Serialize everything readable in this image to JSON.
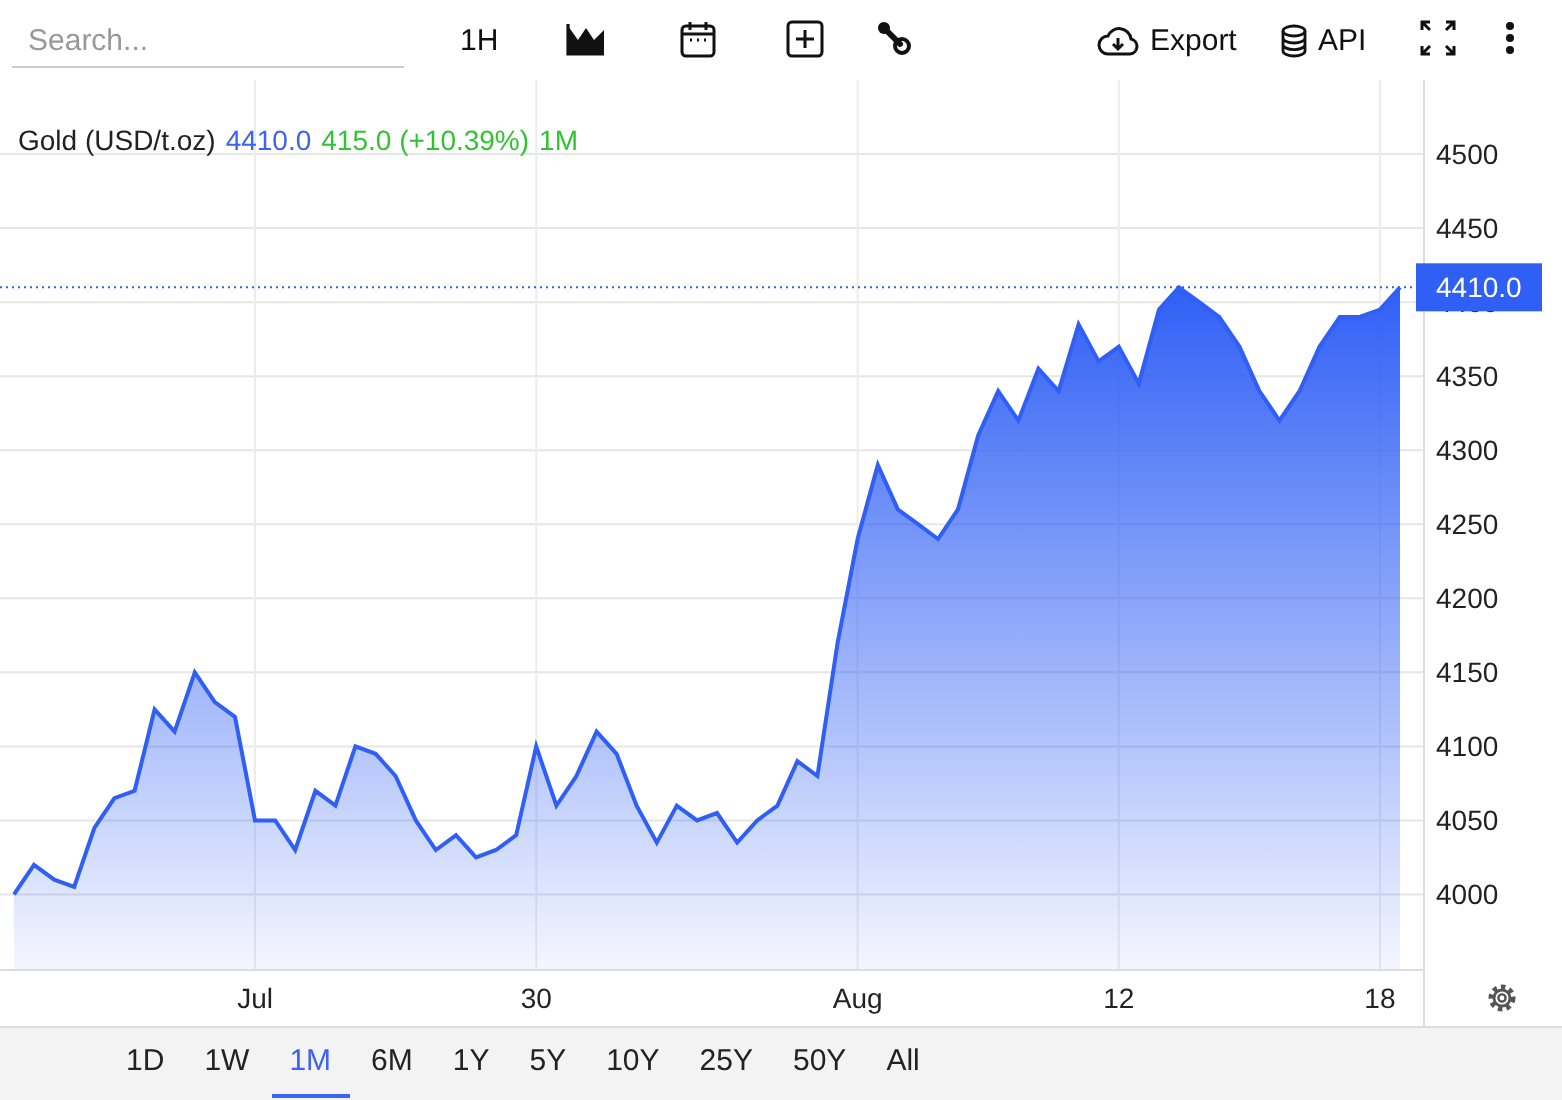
{
  "toolbar": {
    "search": {
      "placeholder": "Search..."
    },
    "interval": "1H",
    "export": "Export",
    "api": "API"
  },
  "legend": {
    "price": "4410.0",
    "change": "415.0 (+10.39%)",
    "period": "1M"
  },
  "price_tag": "4410.0",
  "chart_data": {
    "type": "area",
    "categories": [
      null,
      null,
      null,
      null,
      null,
      null,
      null,
      null,
      null,
      null,
      null,
      null,
      "Jul",
      null,
      null,
      null,
      null,
      null,
      null,
      null,
      null,
      null,
      null,
      null,
      null,
      null,
      "30",
      null,
      null,
      null,
      null,
      null,
      null,
      null,
      null,
      null,
      null,
      null,
      null,
      null,
      null,
      null,
      "Aug",
      null,
      null,
      null,
      null,
      null,
      null,
      null,
      null,
      null,
      null,
      null,
      null,
      "12",
      null,
      null,
      null,
      null,
      null,
      null,
      null,
      null,
      null,
      null,
      null,
      null,
      "18",
      null
    ],
    "series": [
      {
        "name": "Gold (USD/t.oz)",
        "color": "#2f5ff5",
        "values": [
          4000,
          4020,
          4010,
          4005,
          4045,
          4065,
          4070,
          4125,
          4110,
          4150,
          4130,
          4120,
          4050,
          4050,
          4030,
          4070,
          4060,
          4100,
          4095,
          4080,
          4050,
          4030,
          4040,
          4025,
          4030,
          4040,
          4100,
          4060,
          4080,
          4110,
          4095,
          4060,
          4035,
          4060,
          4050,
          4055,
          4035,
          4050,
          4060,
          4090,
          4080,
          4170,
          4240,
          4290,
          4260,
          4250,
          4240,
          4260,
          4310,
          4340,
          4320,
          4355,
          4340,
          4385,
          4360,
          4370,
          4345,
          4395,
          4410,
          4400,
          4390,
          4370,
          4340,
          4320,
          4340,
          4370,
          4390,
          4390,
          4395,
          4410
        ]
      }
    ],
    "ylim": [
      3949,
      4550
    ],
    "grid": true,
    "ref_lines": [
      {
        "axis": "y",
        "value": 4410,
        "color": "#2f5ff5"
      }
    ],
    "yticks": [
      4000,
      4050,
      4100,
      4150,
      4200,
      4250,
      4300,
      4350,
      4400,
      4450,
      4500
    ]
  },
  "ranges": [
    {
      "label": "1D",
      "selected": false
    },
    {
      "label": "1W",
      "selected": false
    },
    {
      "label": "1M",
      "selected": true
    },
    {
      "label": "6M",
      "selected": false
    },
    {
      "label": "1Y",
      "selected": false
    },
    {
      "label": "5Y",
      "selected": false
    },
    {
      "label": "10Y",
      "selected": false
    },
    {
      "label": "25Y",
      "selected": false
    },
    {
      "label": "50Y",
      "selected": false
    },
    {
      "label": "All",
      "selected": false
    }
  ]
}
